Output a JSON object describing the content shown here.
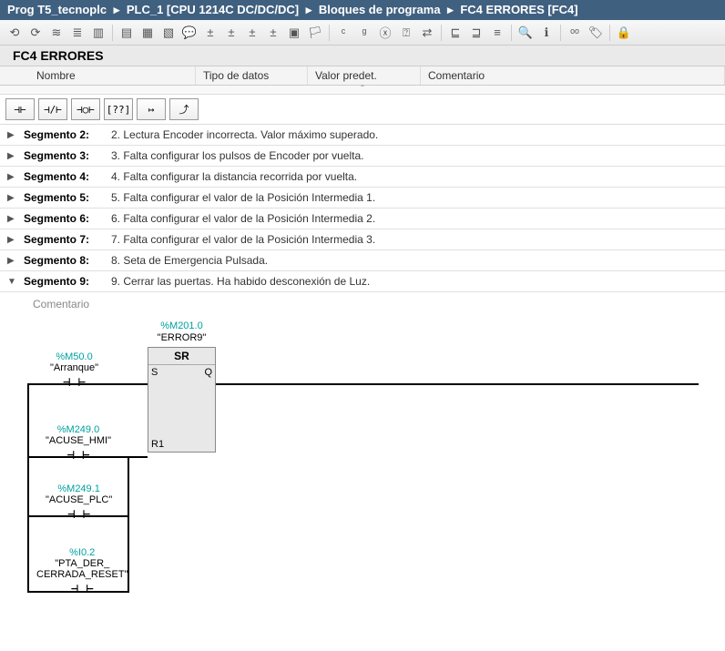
{
  "breadcrumb": {
    "parts": [
      "Prog T5_tecnoplc",
      "PLC_1 [CPU 1214C DC/DC/DC]",
      "Bloques de programa",
      "FC4 ERRORES [FC4]"
    ],
    "sep": "▸"
  },
  "block_title": "FC4 ERRORES",
  "columns": {
    "name": "Nombre",
    "type": "Tipo de datos",
    "preset": "Valor predet.",
    "comment": "Comentario"
  },
  "ladder_buttons": [
    "⊣⊢",
    "⊣/⊢",
    "⊣○⊢",
    "[??]",
    "↦",
    "⤴"
  ],
  "segments": [
    {
      "expanded": false,
      "label": "Segmento 2:",
      "desc": "2. Lectura Encoder incorrecta. Valor máximo superado."
    },
    {
      "expanded": false,
      "label": "Segmento 3:",
      "desc": "3. Falta configurar los pulsos de Encoder por vuelta."
    },
    {
      "expanded": false,
      "label": "Segmento 4:",
      "desc": "4. Falta configurar la distancia recorrida por vuelta."
    },
    {
      "expanded": false,
      "label": "Segmento 5:",
      "desc": "5. Falta configurar el valor de la Posición Intermedia 1."
    },
    {
      "expanded": false,
      "label": "Segmento 6:",
      "desc": "6. Falta configurar el valor de la Posición Intermedia 2."
    },
    {
      "expanded": false,
      "label": "Segmento 7:",
      "desc": "7. Falta configurar el valor de la Posición Intermedia 3."
    },
    {
      "expanded": false,
      "label": "Segmento 8:",
      "desc": "8. Seta de Emergencia Pulsada."
    },
    {
      "expanded": true,
      "label": "Segmento 9:",
      "desc": "9. Cerrar las puertas. Ha habido desconexión de Luz."
    }
  ],
  "comment_placeholder": "Comentario",
  "ladder": {
    "sr": {
      "addr": "%M201.0",
      "name": "\"ERROR9\"",
      "title": "SR",
      "pins": {
        "s": "S",
        "q": "Q",
        "r1": "R1"
      }
    },
    "contacts": [
      {
        "id": "arranque",
        "addr": "%M50.0",
        "name": "\"Arranque\"",
        "symbol": "⊣ ⊢"
      },
      {
        "id": "acuse-hmi",
        "addr": "%M249.0",
        "name": "\"ACUSE_HMI\"",
        "symbol": "⊣ ⊢"
      },
      {
        "id": "acuse-plc",
        "addr": "%M249.1",
        "name": "\"ACUSE_PLC\"",
        "symbol": "⊣ ⊢"
      },
      {
        "id": "pta-der",
        "addr": "%I0.2",
        "name": "\"PTA_DER_\nCERRADA_RESET\"",
        "symbol": "⊣ ⊢"
      }
    ]
  }
}
